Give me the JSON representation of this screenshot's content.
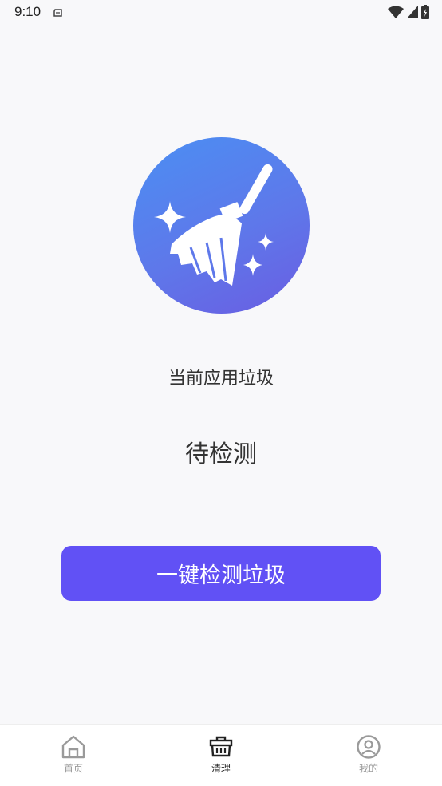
{
  "status_bar": {
    "time": "9:10",
    "icons": [
      "notification-icon",
      "wifi-icon",
      "signal-icon",
      "battery-icon"
    ]
  },
  "hero": {
    "icon": "broom-icon",
    "colors": [
      "#4b8ff3",
      "#6a5de2"
    ]
  },
  "main": {
    "label": "当前应用垃圾",
    "status": "待检测",
    "scan_button": "一键检测垃圾"
  },
  "bottom_nav": {
    "items": [
      {
        "label": "首页",
        "icon": "home-icon",
        "active": false
      },
      {
        "label": "清理",
        "icon": "clean-icon",
        "active": true
      },
      {
        "label": "我的",
        "icon": "profile-icon",
        "active": false
      }
    ]
  },
  "colors": {
    "accent": "#6151f5",
    "background": "#f8f8fa"
  }
}
